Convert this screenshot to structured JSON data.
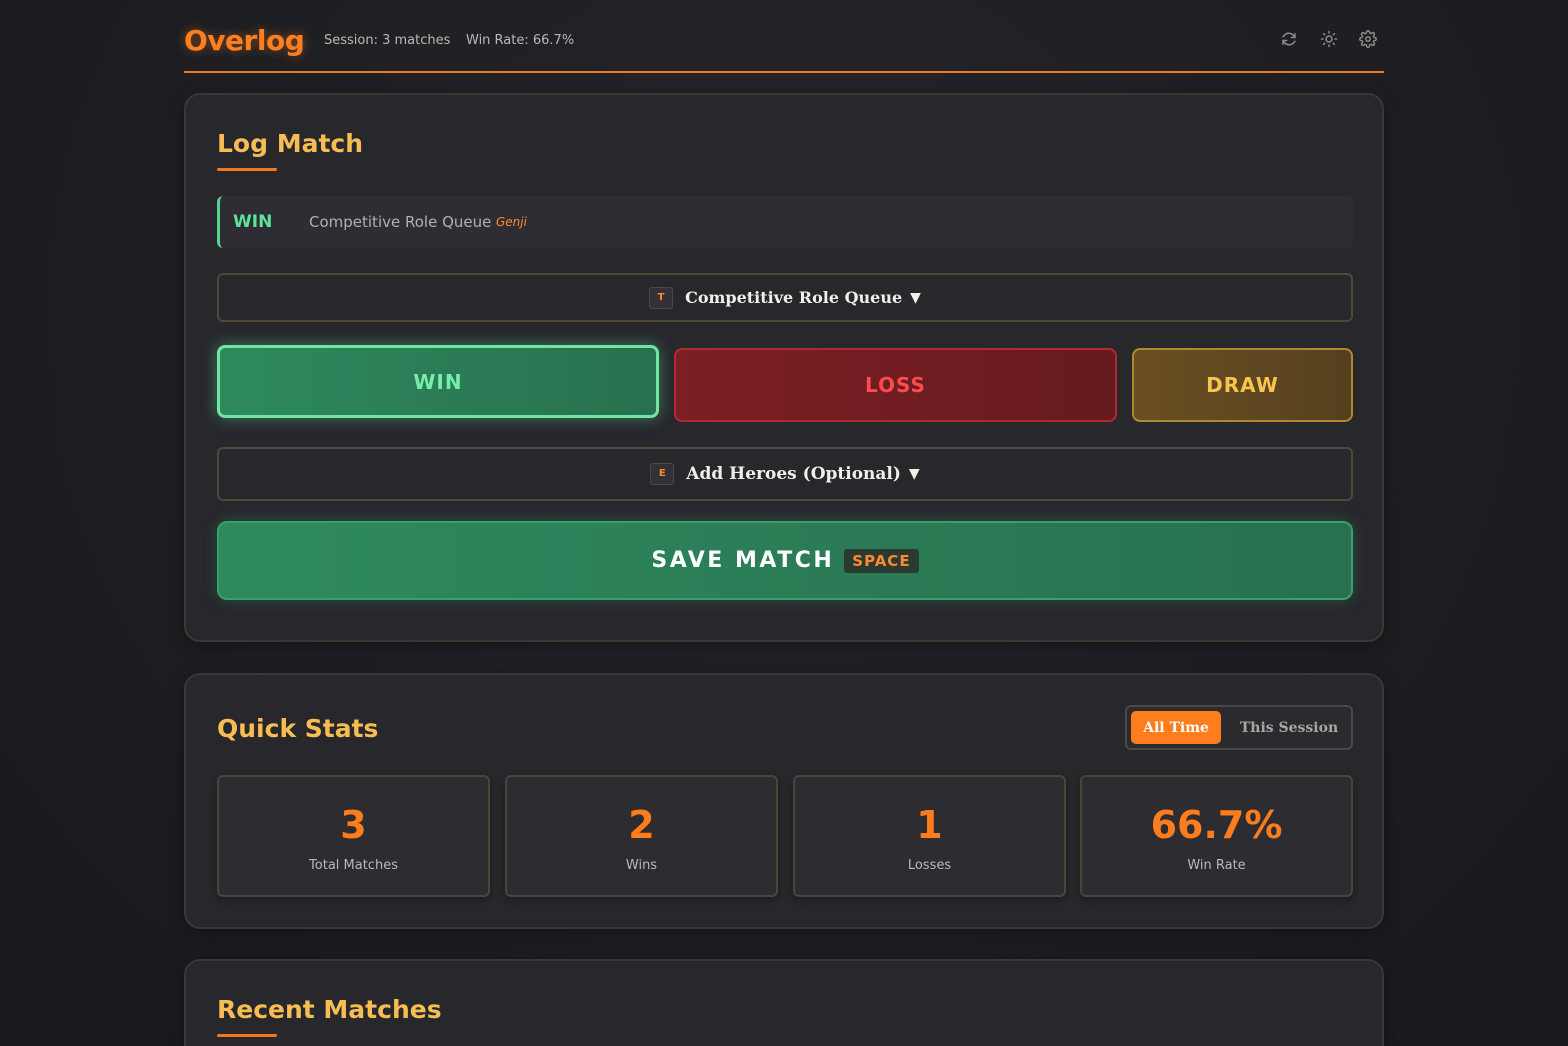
{
  "header": {
    "logo": "Overlog",
    "session": "Session: 3 matches",
    "win_rate": "Win Rate: 66.7%",
    "icons": [
      "refresh-icon",
      "sun-icon",
      "gear-icon"
    ]
  },
  "log_match": {
    "title": "Log Match",
    "last_entry": {
      "result": "WIN",
      "mode": "Competitive Role Queue",
      "hero": "Genji"
    },
    "mode_selector": {
      "key": "T",
      "label": "Competitive Role Queue",
      "caret": "▼"
    },
    "results": {
      "win": "WIN",
      "loss": "LOSS",
      "draw": "DRAW",
      "selected": "WIN"
    },
    "heroes_selector": {
      "key": "E",
      "label": "Add Heroes (Optional)",
      "caret": "▼"
    },
    "save": {
      "label": "SAVE MATCH",
      "key": "SPACE"
    }
  },
  "quick_stats": {
    "title": "Quick Stats",
    "toggle": {
      "active": "All Time",
      "inactive": "This Session"
    },
    "stats": [
      {
        "value": "3",
        "label": "Total Matches"
      },
      {
        "value": "2",
        "label": "Wins"
      },
      {
        "value": "1",
        "label": "Losses"
      },
      {
        "value": "66.7%",
        "label": "Win Rate"
      }
    ]
  },
  "recent_matches": {
    "title": "Recent Matches"
  },
  "colors": {
    "accent": "#ff7d1d",
    "title": "#f6bd53",
    "win": "#5fe29b",
    "loss": "#ff4a4e",
    "draw": "#f8c54c"
  }
}
